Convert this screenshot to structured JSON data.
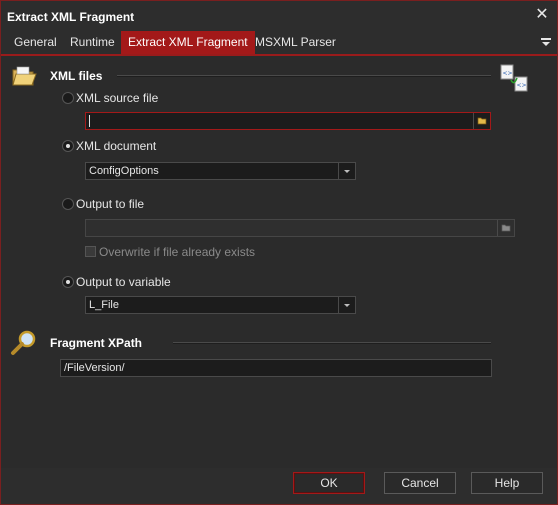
{
  "window": {
    "title": "Extract XML Fragment",
    "close_symbol": "✕"
  },
  "tabs": [
    {
      "label": "General",
      "active": false
    },
    {
      "label": "Runtime",
      "active": false
    },
    {
      "label": "Extract XML Fragment",
      "active": true
    },
    {
      "label": "MSXML Parser",
      "active": false
    }
  ],
  "xml_files": {
    "section_title": "XML files",
    "icon": "folder-icon",
    "corner_icon": "xml-files-icon",
    "source_file": {
      "label": "XML source file",
      "selected": false,
      "value": ""
    },
    "document": {
      "label": "XML document",
      "selected": true,
      "value": "ConfigOptions"
    },
    "output_file": {
      "label": "Output to file",
      "selected": false,
      "value": "",
      "overwrite_label": "Overwrite if file already exists",
      "overwrite_checked": false
    },
    "output_variable": {
      "label": "Output to variable",
      "selected": true,
      "value": "L_File"
    }
  },
  "fragment": {
    "section_title": "Fragment XPath",
    "icon": "magnifier-icon",
    "value": "/FileVersion/"
  },
  "buttons": {
    "ok": "OK",
    "cancel": "Cancel",
    "help": "Help"
  },
  "colors": {
    "accent": "#a31919",
    "background": "#2b2b2b",
    "field": "#1c1c1c"
  }
}
